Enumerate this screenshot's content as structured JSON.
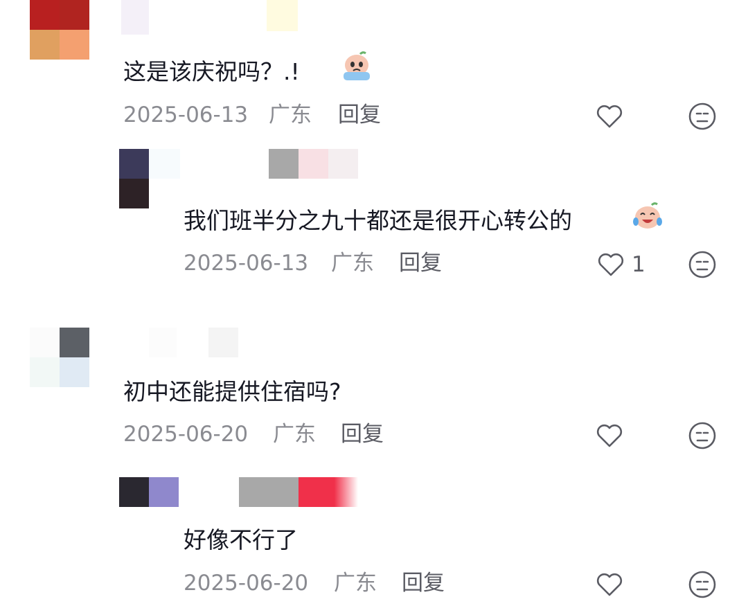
{
  "comments": [
    {
      "text": "这是该庆祝吗？.!",
      "date": "2025-06-13",
      "location": "广东",
      "reply_label": "回复",
      "emoji": "crying-emoji",
      "like_count": "",
      "avatar_colors": [
        "#b82020",
        "#b82020",
        "#e0a060",
        "#f4a070"
      ],
      "name_colors": [
        "#f4f0f8",
        "#fffbe0"
      ],
      "replies": [
        {
          "text": "我们班半分之九十都还是很开心转公的",
          "date": "2025-06-13",
          "location": "广东",
          "reply_label": "回复",
          "emoji": "laugh-cry-emoji",
          "like_count": "1",
          "avatar_colors": [
            "#3c3a5a",
            "#2d2226"
          ],
          "name_colors": [
            "#a8a8a8",
            "#f8e0e4",
            "#f4eef0"
          ]
        }
      ]
    },
    {
      "text": "初中还能提供住宿吗?",
      "date": "2025-06-20",
      "location": "广东",
      "reply_label": "回复",
      "like_count": "",
      "avatar_colors": [
        "#5c6066",
        "#e0eaf4"
      ],
      "name_colors": [
        "#f4f4f4"
      ],
      "replies": [
        {
          "text": "好像不行了",
          "date": "2025-06-20",
          "location": "广东",
          "reply_label": "回复",
          "like_count": "",
          "avatar_colors": [
            "#2a2830",
            "#8f88cc"
          ],
          "name_colors": [
            "#a8a8a8",
            "#f0304a"
          ]
        }
      ]
    }
  ],
  "icons": {
    "like": "heart-outline-icon",
    "dislike": "meh-face-icon"
  }
}
